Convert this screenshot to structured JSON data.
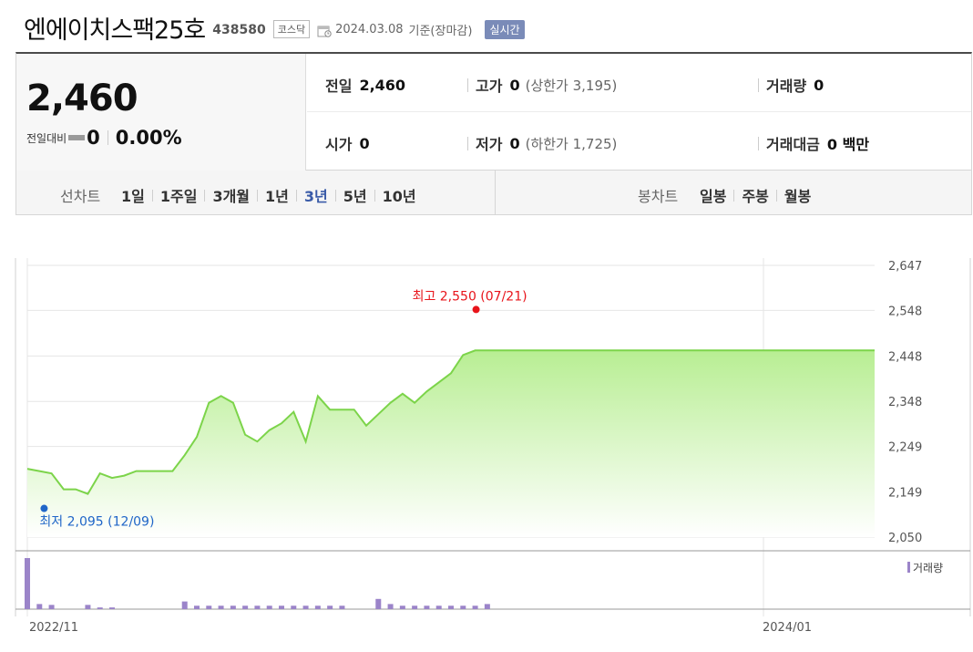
{
  "header": {
    "stock_name": "엔에이치스팩25호",
    "stock_code": "438580",
    "market": "코스닥",
    "date": "2024.03.08",
    "date_suffix": "기준(장마감)",
    "realtime_label": "실시간",
    "calendar_icon": "calendar-icon"
  },
  "price": {
    "current": "2,460",
    "change_label": "전일대비",
    "change_value": "0",
    "change_pct": "0.00%",
    "change_icon": "flat-bar-icon"
  },
  "stats": {
    "prev_close_label": "전일",
    "prev_close": "2,460",
    "high_label": "고가",
    "high": "0",
    "high_sub": "(상한가 3,195)",
    "volume_label": "거래량",
    "volume": "0",
    "open_label": "시가",
    "open": "0",
    "low_label": "저가",
    "low": "0",
    "low_sub": "(하한가 1,725)",
    "amount_label": "거래대금",
    "amount": "0 백만"
  },
  "period": {
    "line_label": "선차트",
    "line_items": [
      "1일",
      "1주일",
      "3개월",
      "1년",
      "3년",
      "5년",
      "10년"
    ],
    "active_item": "3년",
    "candle_label": "봉차트",
    "candle_items": [
      "일봉",
      "주봉",
      "월봉"
    ]
  },
  "colors": {
    "line": "#7cd44a",
    "fill_top": "#bff09b",
    "high_marker": "#e8141a",
    "low_marker": "#2066c8",
    "volume_bar": "#9b84c9",
    "active_tab": "#3a5ba8"
  },
  "chart_data": {
    "type": "area",
    "x_tick_labels": [
      "2022/11",
      "2024/01"
    ],
    "y_ticks": [
      "2,647",
      "2,548",
      "2,448",
      "2,348",
      "2,249",
      "2,149",
      "2,050"
    ],
    "ylim": [
      2050,
      2647
    ],
    "y_tick_values": [
      2647,
      2548,
      2448,
      2348,
      2249,
      2149,
      2050
    ],
    "series": [
      {
        "values": [
          2200,
          2195,
          2190,
          2155,
          2155,
          2145,
          2190,
          2180,
          2185,
          2195,
          2195,
          2195,
          2195,
          2230,
          2270,
          2345,
          2360,
          2345,
          2275,
          2260,
          2285,
          2300,
          2325,
          2260,
          2360,
          2330,
          2330,
          2330,
          2295,
          2320,
          2345,
          2365,
          2345,
          2370,
          2390,
          2410,
          2450,
          2460,
          2460,
          2460,
          2460,
          2460,
          2460,
          2460,
          2460,
          2460,
          2460,
          2460,
          2460,
          2460,
          2460,
          2460,
          2460,
          2460,
          2460,
          2460,
          2460,
          2460,
          2460,
          2460,
          2460,
          2460,
          2460,
          2460,
          2460,
          2460,
          2460,
          2460,
          2460,
          2460,
          2460
        ]
      }
    ],
    "volume": [
      60,
      6,
      5,
      0,
      0,
      5,
      2,
      2,
      0,
      0,
      0,
      0,
      0,
      9,
      4,
      4,
      4,
      4,
      4,
      4,
      4,
      4,
      4,
      4,
      4,
      4,
      4,
      0,
      0,
      12,
      6,
      4,
      4,
      4,
      4,
      4,
      4,
      4,
      6,
      0,
      0,
      0,
      0,
      0,
      0,
      0,
      0,
      0,
      0,
      0,
      0,
      0,
      0,
      0,
      0,
      0,
      0,
      0,
      0,
      0,
      0,
      0,
      0,
      0,
      0,
      0,
      0,
      0,
      0,
      0,
      0
    ],
    "high_annotation": "최고 2,550 (07/21)",
    "high_value": 2550,
    "high_index": 37,
    "low_annotation": "최저 2,095 (12/09)",
    "low_value": 2095,
    "low_index": 5,
    "volume_legend": "거래량",
    "grid": true
  }
}
